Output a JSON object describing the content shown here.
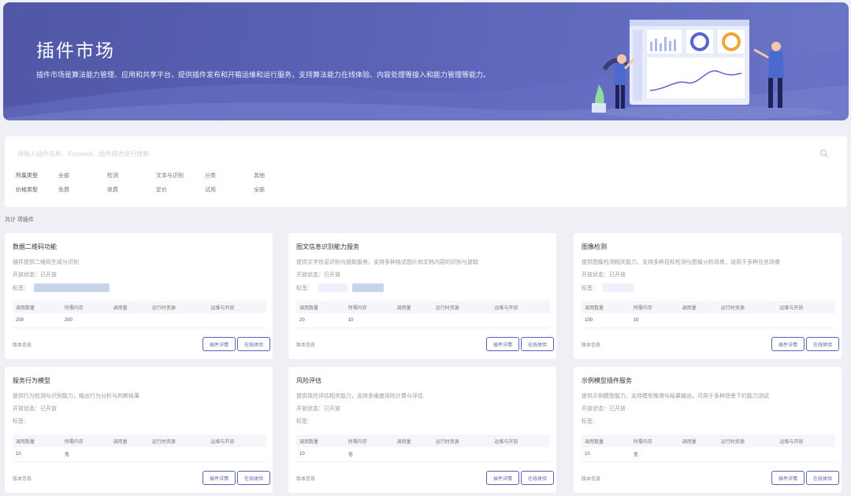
{
  "banner": {
    "title": "插件市场",
    "description": "插件市场是算法能力管理、应用和共享平台，提供插件发布和开箱运维和运行服务，支持算法能力在线体验、内容处理等接入和能力管理等能力。"
  },
  "search": {
    "placeholder": "请输入插件名称、Keyword、插件描述进行搜索"
  },
  "filters": [
    {
      "label": "所属类型",
      "options": [
        "全部",
        "检测",
        "文本与识别",
        "分类",
        "其他"
      ]
    },
    {
      "label": "价格类型",
      "options": [
        "免费",
        "收费",
        "定价",
        "试用",
        "全部"
      ]
    }
  ],
  "total": {
    "prefix": "共计",
    "count": "",
    "suffix": "项插件"
  },
  "table_headers": [
    "调用数量",
    "所需内存",
    "调用量",
    "运行时资源",
    "运维与开放"
  ],
  "cards": [
    {
      "title": "数据二维码功能",
      "desc1": "插件提供二维码生成与识别",
      "desc2": "开放状态：已开放",
      "tag_label": "标签：",
      "row": [
        "200",
        "200",
        "",
        "",
        ""
      ],
      "version": "版本信息",
      "btn1": "插件详情",
      "btn2": "在线体验"
    },
    {
      "title": "图文信息识别能力服务",
      "desc1": "提供文字信息识别与提取服务，支持多种格式图片和文档内容的识别与提取",
      "desc2": "开放状态：已开放",
      "tag_label": "标签：",
      "row": [
        "20",
        "10",
        "",
        "",
        ""
      ],
      "version": "版本信息",
      "btn1": "插件详情",
      "btn2": "在线体验"
    },
    {
      "title": "图像检测",
      "desc1": "提供图像检测相关能力，支持多种目标检测与图像分析场景，适用于多种业务场景",
      "desc2": "开放状态：已开放",
      "tag_label": "标签：",
      "row": [
        "100",
        "10",
        "",
        "",
        ""
      ],
      "version": "版本信息",
      "btn1": "插件详情",
      "btn2": "在线体验"
    },
    {
      "title": "服务行为模型",
      "desc1": "提供行为检测与识别能力，输出行为分析与判断结果",
      "desc2": "开放状态：已开放",
      "tag_label": "标签：",
      "row": [
        "10",
        "无",
        "",
        "",
        ""
      ],
      "version": "版本信息",
      "btn1": "插件详情",
      "btn2": "在线体验"
    },
    {
      "title": "风险评估",
      "desc1": "提供风险评估相关能力，支持多维度风险计算与评估",
      "desc2": "开放状态：已开放",
      "tag_label": "标签：",
      "row": [
        "10",
        "无",
        "",
        "",
        ""
      ],
      "version": "版本信息",
      "btn1": "插件详情",
      "btn2": "在线体验"
    },
    {
      "title": "示例模型插件服务",
      "desc1": "提供示例模型能力，支持模型推理与结果输出，可用于多种场景下的能力测试",
      "desc2": "开放状态：已开放",
      "tag_label": "标签：",
      "row": [
        "10",
        "无",
        "",
        "",
        ""
      ],
      "version": "版本信息",
      "btn1": "插件详情",
      "btn2": "在线体验"
    }
  ],
  "colors": {
    "accent": "#5a63b6",
    "banner": "#5157a6",
    "background": "#eef0f6"
  }
}
